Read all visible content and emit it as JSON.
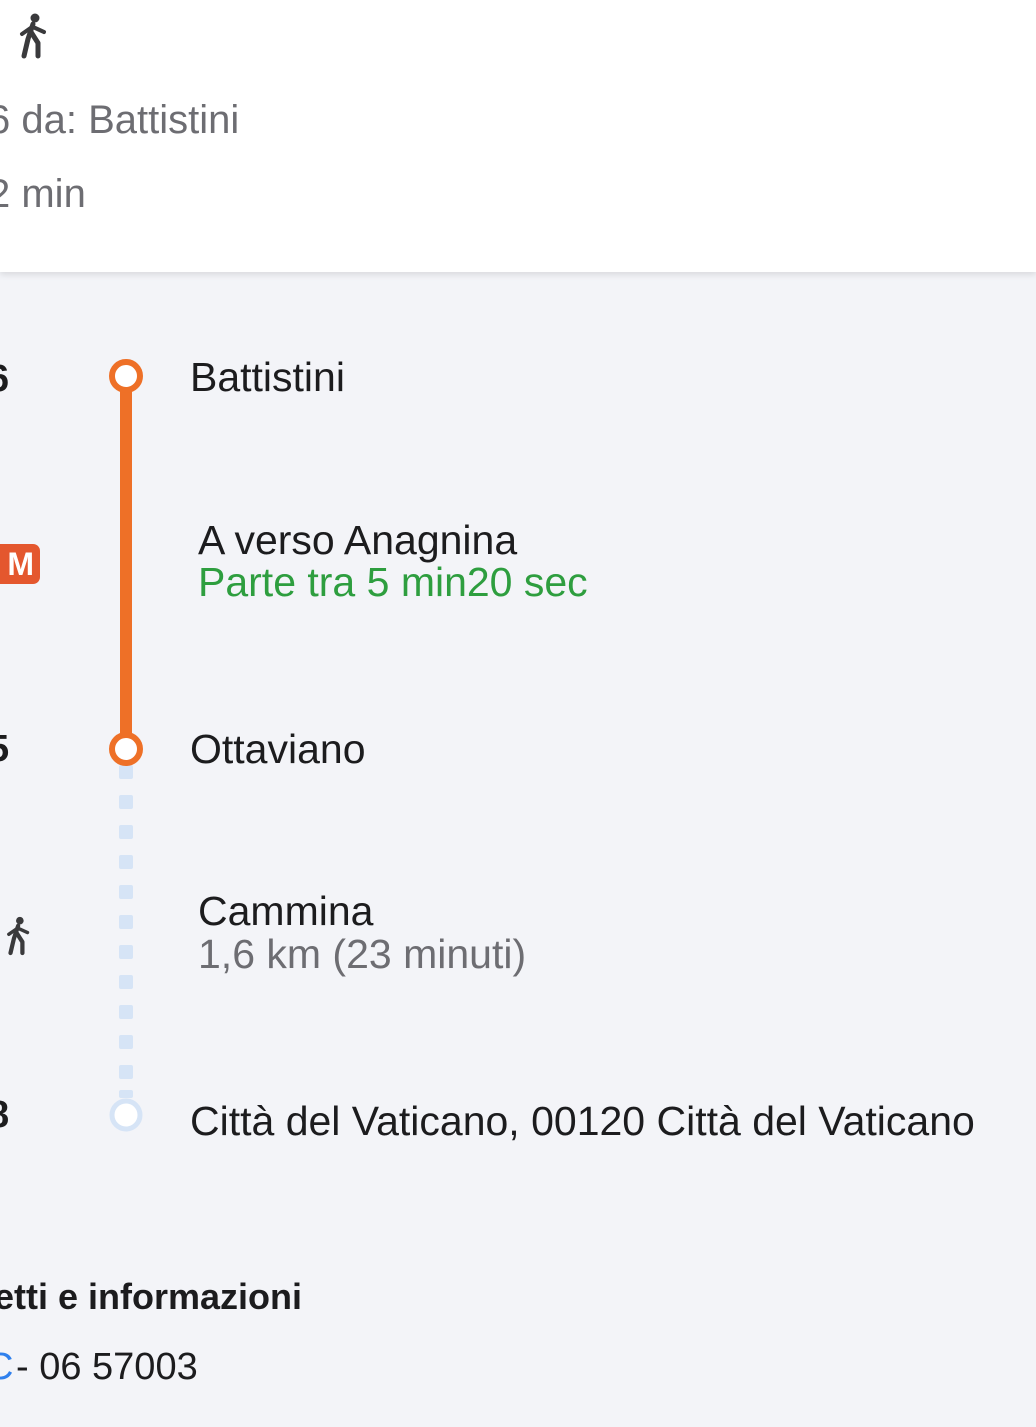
{
  "summary": {
    "icon": "walking-person-icon",
    "line1": "6 da: Battistini",
    "line2": "2 min"
  },
  "itinerary": {
    "start": {
      "time": "6",
      "name": "Battistini"
    },
    "metro_segment": {
      "badge": "M",
      "title": "A verso Anagnina",
      "status": "Parte tra 5 min20 sec",
      "line_color": "#ee7027"
    },
    "transfer": {
      "time": "5",
      "name": "Ottaviano"
    },
    "walk_segment": {
      "icon": "walking-person-icon",
      "title": "Cammina",
      "detail": "1,6 km (23 minuti)",
      "line_color": "#d6e4f6"
    },
    "destination": {
      "time": "8",
      "name": "Città del Vaticano, 00120 Città del Vaticano"
    }
  },
  "contacts": {
    "title": "etti e informazioni",
    "prefix": "C",
    "text": "- 06 57003"
  },
  "colors": {
    "accent_orange": "#ee7027",
    "status_green": "#2e9e3f",
    "link_blue": "#2f80ed",
    "background": "#f3f4f8"
  }
}
